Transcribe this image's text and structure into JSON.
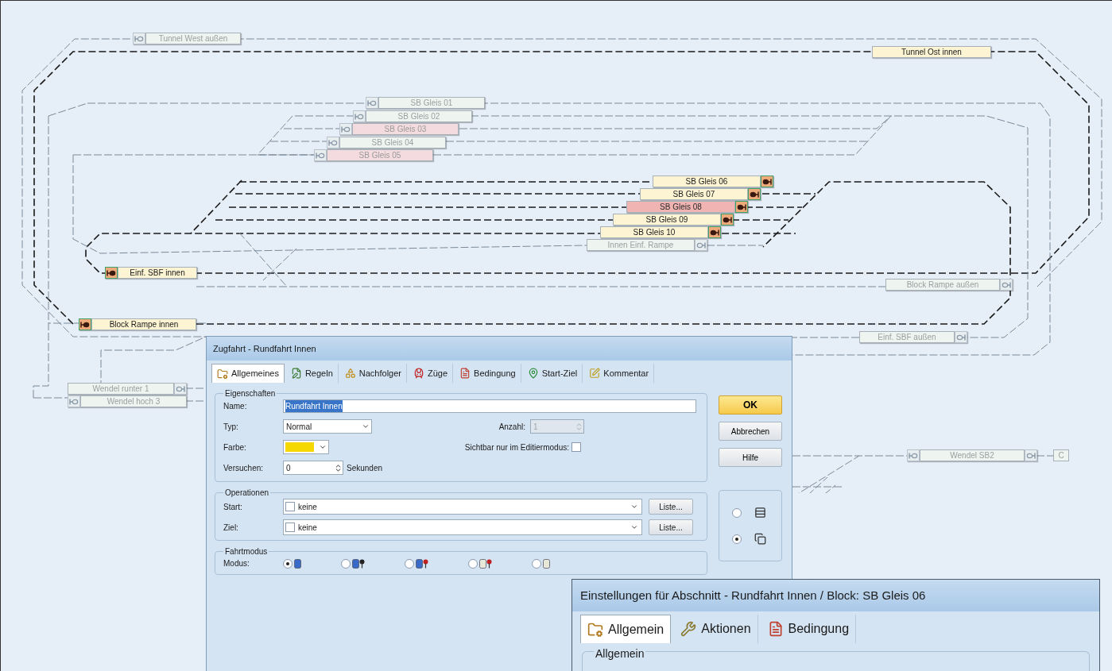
{
  "canvas": {
    "blocks": [
      {
        "label": "Tunnel West außen",
        "in_route": false,
        "occupied": false,
        "kind": "left"
      },
      {
        "label": "Tunnel Ost innen",
        "in_route": true,
        "occupied": false,
        "kind": "plain"
      },
      {
        "label": "SB Gleis 01",
        "in_route": false,
        "occupied": false,
        "kind": "left"
      },
      {
        "label": "SB Gleis 02",
        "in_route": false,
        "occupied": false,
        "kind": "left"
      },
      {
        "label": "SB Gleis 03",
        "in_route": false,
        "occupied": true,
        "kind": "left"
      },
      {
        "label": "SB Gleis 04",
        "in_route": false,
        "occupied": false,
        "kind": "left"
      },
      {
        "label": "SB Gleis 05",
        "in_route": false,
        "occupied": true,
        "kind": "left"
      },
      {
        "label": "SB Gleis 06",
        "in_route": true,
        "occupied": false,
        "kind": "right"
      },
      {
        "label": "SB Gleis 07",
        "in_route": true,
        "occupied": false,
        "kind": "right"
      },
      {
        "label": "SB Gleis 08",
        "in_route": true,
        "occupied": true,
        "kind": "right"
      },
      {
        "label": "SB Gleis 09",
        "in_route": true,
        "occupied": false,
        "kind": "right"
      },
      {
        "label": "SB Gleis 10",
        "in_route": true,
        "occupied": false,
        "kind": "right"
      },
      {
        "label": "Innen Einf. Rampe",
        "in_route": false,
        "occupied": false,
        "kind": "right"
      },
      {
        "label": "Einf. SBF innen",
        "in_route": true,
        "occupied": false,
        "kind": "left"
      },
      {
        "label": "Block Rampe außen",
        "in_route": false,
        "occupied": false,
        "kind": "right"
      },
      {
        "label": "Block Rampe innen",
        "in_route": true,
        "occupied": false,
        "kind": "left"
      },
      {
        "label": "Einf. SBF außen",
        "in_route": false,
        "occupied": false,
        "kind": "right"
      },
      {
        "label": "Wendel runter 1",
        "in_route": false,
        "occupied": false,
        "kind": "right"
      },
      {
        "label": "Wendel hoch 3",
        "in_route": false,
        "occupied": false,
        "kind": "left"
      },
      {
        "label": "Wendel SB2",
        "in_route": false,
        "occupied": false,
        "kind": "both"
      }
    ],
    "end_marker": "C"
  },
  "dialog": {
    "title": "Zugfahrt - Rundfahrt Innen",
    "tabs": [
      {
        "label": "Allgemeines",
        "selected": true
      },
      {
        "label": "Regeln",
        "selected": false
      },
      {
        "label": "Nachfolger",
        "selected": false
      },
      {
        "label": "Züge",
        "selected": false
      },
      {
        "label": "Bedingung",
        "selected": false
      },
      {
        "label": "Start-Ziel",
        "selected": false
      },
      {
        "label": "Kommentar",
        "selected": false
      }
    ],
    "properties": {
      "title": "Eigenschaften",
      "name_label": "Name:",
      "name_value": "Rundfahrt Innen",
      "name_selected": true,
      "type_label": "Typ:",
      "type_value": "Normal",
      "count_label": "Anzahl:",
      "count_value": "1",
      "count_disabled": true,
      "color_label": "Farbe:",
      "color": "#f5d800",
      "edit_only_label": "Sichtbar nur im Editiermodus:",
      "edit_only_checked": false,
      "attempts_label": "Versuchen:",
      "attempts_value": "0",
      "attempts_unit": "Sekunden"
    },
    "operations": {
      "title": "Operationen",
      "rows": [
        {
          "label": "Start:",
          "checked": false,
          "value": "keine",
          "button": "Liste..."
        },
        {
          "label": "Ziel:",
          "checked": false,
          "value": "keine",
          "button": "Liste..."
        }
      ]
    },
    "mode": {
      "title": "Fahrtmodus",
      "label": "Modus:",
      "options": [
        {
          "selected": true
        },
        {
          "selected": false
        },
        {
          "selected": false
        },
        {
          "selected": false
        },
        {
          "selected": false
        }
      ]
    },
    "buttons": [
      {
        "label": "OK",
        "default": true
      },
      {
        "label": "Abbrechen",
        "default": false
      },
      {
        "label": "Hilfe",
        "default": false
      }
    ],
    "view_options": [
      {
        "selected": false
      },
      {
        "selected": true
      }
    ]
  },
  "dialog2": {
    "title": "Einstellungen für Abschnitt - Rundfahrt Innen / Block: SB Gleis 06",
    "tabs": [
      {
        "label": "Allgemein",
        "selected": true
      },
      {
        "label": "Aktionen",
        "selected": false
      },
      {
        "label": "Bedingung",
        "selected": false
      }
    ],
    "group_title": "Allgemein"
  }
}
